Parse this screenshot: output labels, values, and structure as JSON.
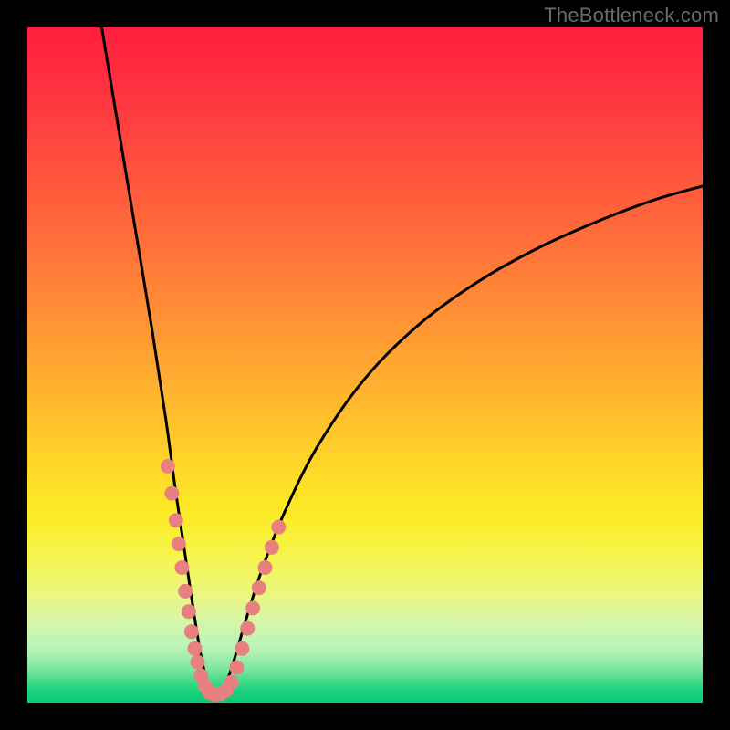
{
  "watermark": "TheBottleneck.com",
  "colors": {
    "background_frame": "#000000",
    "curve_stroke": "#000000",
    "dot_fill": "#e98080",
    "gradient_top": "#ff1f3e",
    "gradient_bottom": "#0fca76",
    "watermark_text": "#6b6b6b"
  },
  "chart_data": {
    "type": "line",
    "title": "",
    "xlabel": "",
    "ylabel": "",
    "xlim": [
      0,
      100
    ],
    "ylim": [
      0,
      100
    ],
    "note": "Axes are percent-of-canvas; no tick labels shown. Curve is a V-shaped dip with minimum near x≈27, y≈1 and two arms rising toward the top. Dots cluster near the bottom of the V along both arms.",
    "series": [
      {
        "name": "curve",
        "kind": "line",
        "points": [
          {
            "x": 11.0,
            "y": 100.0
          },
          {
            "x": 13.5,
            "y": 85.0
          },
          {
            "x": 16.0,
            "y": 70.0
          },
          {
            "x": 18.5,
            "y": 55.0
          },
          {
            "x": 20.5,
            "y": 42.0
          },
          {
            "x": 22.0,
            "y": 31.0
          },
          {
            "x": 23.5,
            "y": 21.0
          },
          {
            "x": 24.7,
            "y": 13.0
          },
          {
            "x": 25.7,
            "y": 7.0
          },
          {
            "x": 26.5,
            "y": 3.5
          },
          {
            "x": 27.2,
            "y": 1.5
          },
          {
            "x": 28.0,
            "y": 1.0
          },
          {
            "x": 29.0,
            "y": 2.0
          },
          {
            "x": 30.2,
            "y": 5.0
          },
          {
            "x": 32.0,
            "y": 11.0
          },
          {
            "x": 34.5,
            "y": 19.0
          },
          {
            "x": 38.0,
            "y": 28.0
          },
          {
            "x": 43.0,
            "y": 38.0
          },
          {
            "x": 50.0,
            "y": 48.0
          },
          {
            "x": 58.0,
            "y": 56.0
          },
          {
            "x": 67.0,
            "y": 62.5
          },
          {
            "x": 76.0,
            "y": 67.5
          },
          {
            "x": 85.0,
            "y": 71.5
          },
          {
            "x": 93.0,
            "y": 74.5
          },
          {
            "x": 100.0,
            "y": 76.5
          }
        ]
      },
      {
        "name": "dots",
        "kind": "scatter",
        "points": [
          {
            "x": 20.8,
            "y": 35.0
          },
          {
            "x": 21.4,
            "y": 31.0
          },
          {
            "x": 22.0,
            "y": 27.0
          },
          {
            "x": 22.4,
            "y": 23.5
          },
          {
            "x": 22.9,
            "y": 20.0
          },
          {
            "x": 23.4,
            "y": 16.5
          },
          {
            "x": 23.9,
            "y": 13.5
          },
          {
            "x": 24.3,
            "y": 10.5
          },
          {
            "x": 24.8,
            "y": 8.0
          },
          {
            "x": 25.2,
            "y": 6.0
          },
          {
            "x": 25.7,
            "y": 4.0
          },
          {
            "x": 26.3,
            "y": 2.5
          },
          {
            "x": 27.0,
            "y": 1.5
          },
          {
            "x": 27.8,
            "y": 1.2
          },
          {
            "x": 28.6,
            "y": 1.3
          },
          {
            "x": 29.4,
            "y": 1.8
          },
          {
            "x": 30.2,
            "y": 3.0
          },
          {
            "x": 31.0,
            "y": 5.2
          },
          {
            "x": 31.8,
            "y": 8.0
          },
          {
            "x": 32.6,
            "y": 11.0
          },
          {
            "x": 33.4,
            "y": 14.0
          },
          {
            "x": 34.3,
            "y": 17.0
          },
          {
            "x": 35.2,
            "y": 20.0
          },
          {
            "x": 36.2,
            "y": 23.0
          },
          {
            "x": 37.2,
            "y": 26.0
          }
        ]
      }
    ]
  }
}
